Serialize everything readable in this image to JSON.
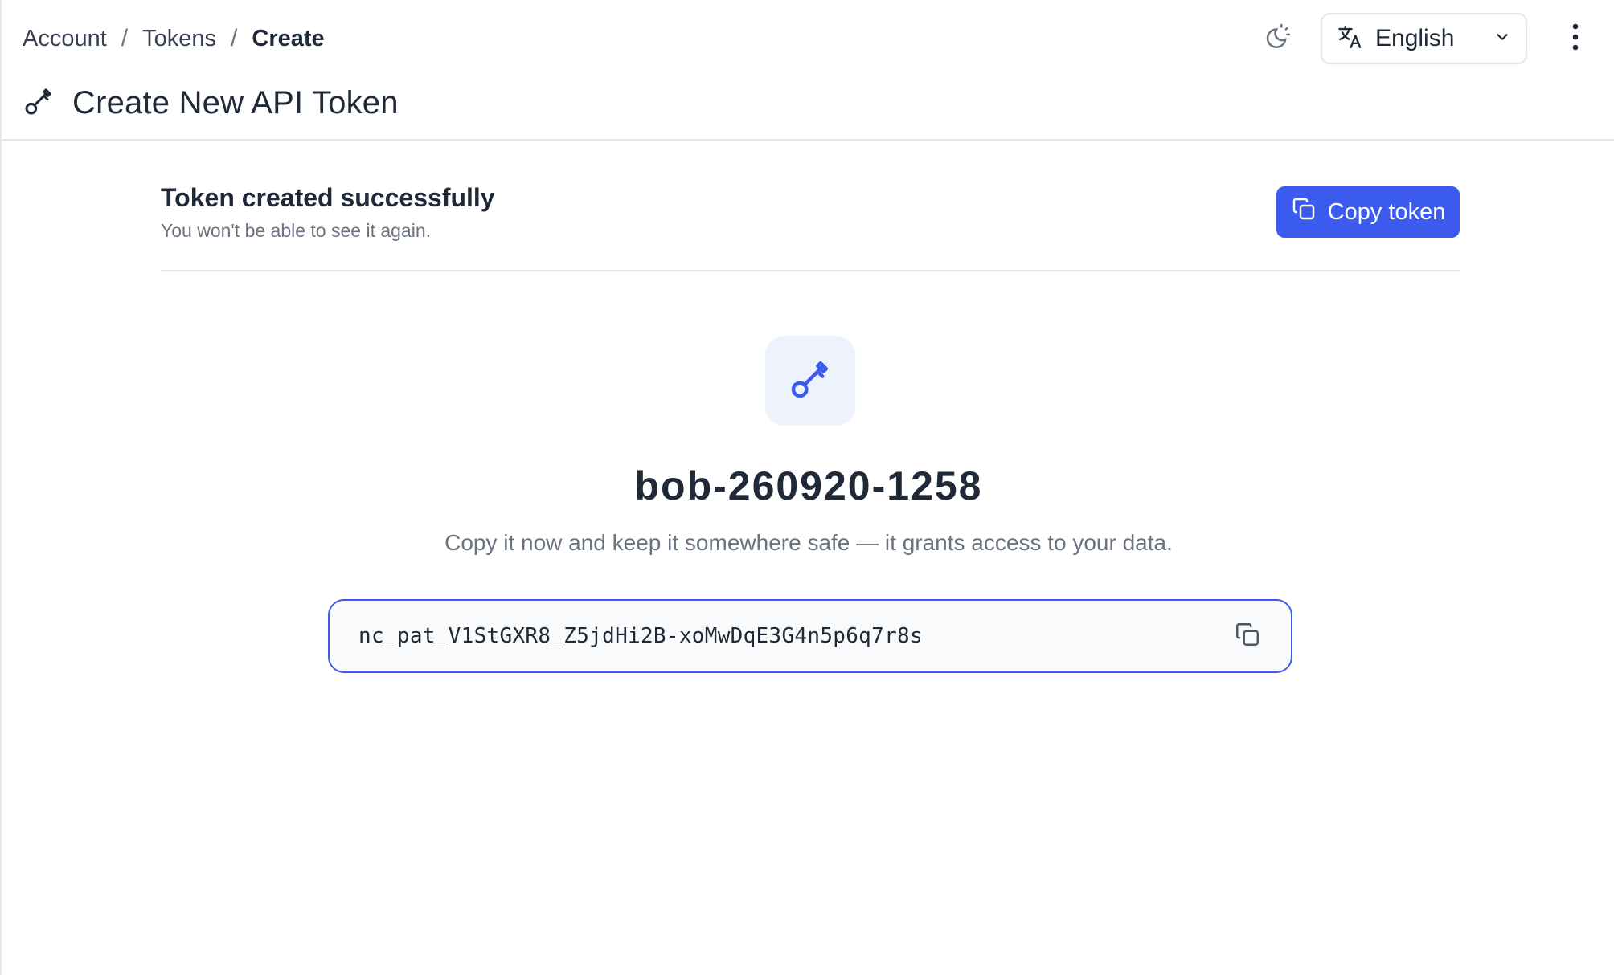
{
  "breadcrumb": {
    "items": [
      "Account",
      "Tokens"
    ],
    "separator": "/",
    "current": "Create"
  },
  "header": {
    "title": "Create New API Token",
    "title_icon": "key-icon",
    "theme_icon": "moon-sun-icon",
    "language": {
      "icon": "translate-icon",
      "selected": "English"
    },
    "more_icon": "more-vertical-icon"
  },
  "notice": {
    "heading": "Token created successfully",
    "subtext": "You won't be able to see it again.",
    "copy_button": {
      "label": "Copy token",
      "icon": "copy-icon"
    }
  },
  "token": {
    "name": "bob-260920-1258",
    "hint": "Copy it now and keep it somewhere safe — it grants access to your data.",
    "value": "nc_pat_V1StGXR8_Z5jdHi2B-xoMwDqE3G4n5p6q7r8s"
  },
  "colors": {
    "accent": "#3b5bef",
    "tile_bg": "#eef2fd",
    "text": "#1f2937",
    "muted": "#6b7280",
    "border": "#e5e7eb"
  }
}
